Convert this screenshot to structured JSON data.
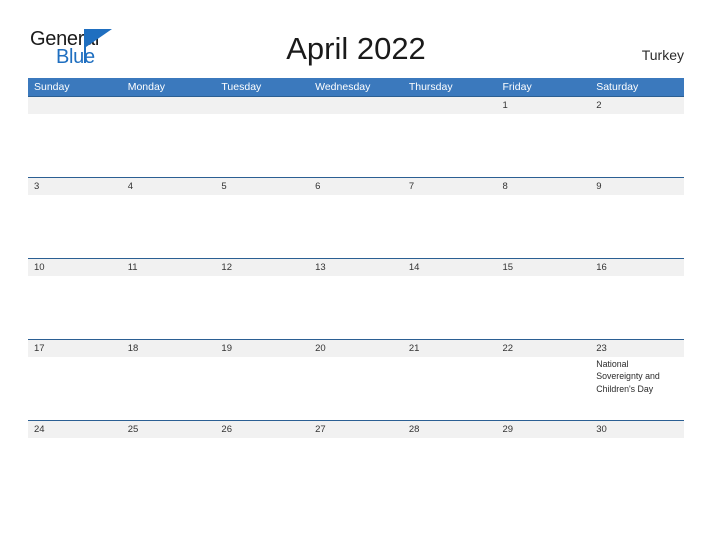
{
  "header": {
    "logo": {
      "word_one": "General",
      "word_two": "Blue",
      "flag_icon": "blue-triangle-flag-icon",
      "brand_color": "#1f6fc0"
    },
    "title": "April 2022",
    "country": "Turkey"
  },
  "calendar": {
    "month": "April",
    "year": "2022",
    "header_color": "#3b79bd",
    "date_band_color": "#f1f1f1",
    "separator_color": "#2b5f93",
    "weekdays": [
      "Sunday",
      "Monday",
      "Tuesday",
      "Wednesday",
      "Thursday",
      "Friday",
      "Saturday"
    ],
    "weeks": [
      {
        "days": [
          {
            "date": "",
            "event": ""
          },
          {
            "date": "",
            "event": ""
          },
          {
            "date": "",
            "event": ""
          },
          {
            "date": "",
            "event": ""
          },
          {
            "date": "",
            "event": ""
          },
          {
            "date": "1",
            "event": ""
          },
          {
            "date": "2",
            "event": ""
          }
        ]
      },
      {
        "days": [
          {
            "date": "3",
            "event": ""
          },
          {
            "date": "4",
            "event": ""
          },
          {
            "date": "5",
            "event": ""
          },
          {
            "date": "6",
            "event": ""
          },
          {
            "date": "7",
            "event": ""
          },
          {
            "date": "8",
            "event": ""
          },
          {
            "date": "9",
            "event": ""
          }
        ]
      },
      {
        "days": [
          {
            "date": "10",
            "event": ""
          },
          {
            "date": "11",
            "event": ""
          },
          {
            "date": "12",
            "event": ""
          },
          {
            "date": "13",
            "event": ""
          },
          {
            "date": "14",
            "event": ""
          },
          {
            "date": "15",
            "event": ""
          },
          {
            "date": "16",
            "event": ""
          }
        ]
      },
      {
        "days": [
          {
            "date": "17",
            "event": ""
          },
          {
            "date": "18",
            "event": ""
          },
          {
            "date": "19",
            "event": ""
          },
          {
            "date": "20",
            "event": ""
          },
          {
            "date": "21",
            "event": ""
          },
          {
            "date": "22",
            "event": ""
          },
          {
            "date": "23",
            "event": "National Sovereignty and Children's Day"
          }
        ]
      },
      {
        "days": [
          {
            "date": "24",
            "event": ""
          },
          {
            "date": "25",
            "event": ""
          },
          {
            "date": "26",
            "event": ""
          },
          {
            "date": "27",
            "event": ""
          },
          {
            "date": "28",
            "event": ""
          },
          {
            "date": "29",
            "event": ""
          },
          {
            "date": "30",
            "event": ""
          }
        ]
      }
    ]
  }
}
